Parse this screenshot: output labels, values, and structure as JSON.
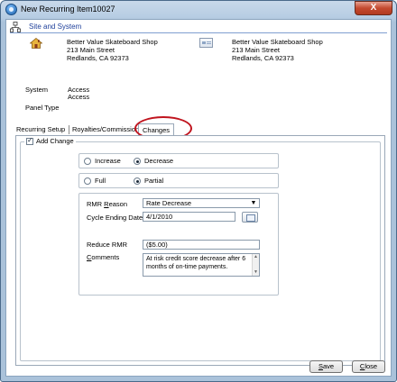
{
  "window": {
    "title": "New Recurring Item10027",
    "close_label": "X"
  },
  "section": {
    "title": "Site and System"
  },
  "site_address": {
    "line1": "Better Value Skateboard Shop",
    "line2": "213 Main Street",
    "line3": "Redlands, CA  92373"
  },
  "billing_address": {
    "line1": "Better Value Skateboard Shop",
    "line2": "213 Main Street",
    "line3": "Redlands, CA  92373"
  },
  "system": {
    "label": "System",
    "value1": "Access",
    "value2": "Access"
  },
  "panel_type": {
    "label": "Panel Type"
  },
  "tabs": [
    {
      "label": "Recurring Setup"
    },
    {
      "label": "Royalties/Commissions"
    },
    {
      "label": "Changes",
      "active": true
    }
  ],
  "add_change": {
    "label": "Add Change",
    "checked": true
  },
  "direction": {
    "options": [
      "Increase",
      "Decrease"
    ],
    "selected": "Decrease"
  },
  "scope": {
    "options": [
      "Full",
      "Partial"
    ],
    "selected": "Partial"
  },
  "rmr_reason": {
    "label_prefix": "RMR ",
    "label_underline": "R",
    "label_rest": "eason",
    "value": "Rate Decrease"
  },
  "cycle_ending_date": {
    "label": "Cycle Ending Date",
    "value": "4/1/2010"
  },
  "reduce_rmr": {
    "label": "Reduce RMR",
    "value": "($5.00)"
  },
  "comments": {
    "label_underline": "C",
    "label_rest": "omments",
    "value": "At risk credit score decrease after 6 months of on-time payments."
  },
  "buttons": {
    "save": {
      "underline": "S",
      "rest": "ave"
    },
    "close": {
      "underline": "C",
      "rest": "lose"
    }
  },
  "colors": {
    "accent": "#1e3f9a",
    "highlight": "#c0141e",
    "close": "#c44a30"
  }
}
